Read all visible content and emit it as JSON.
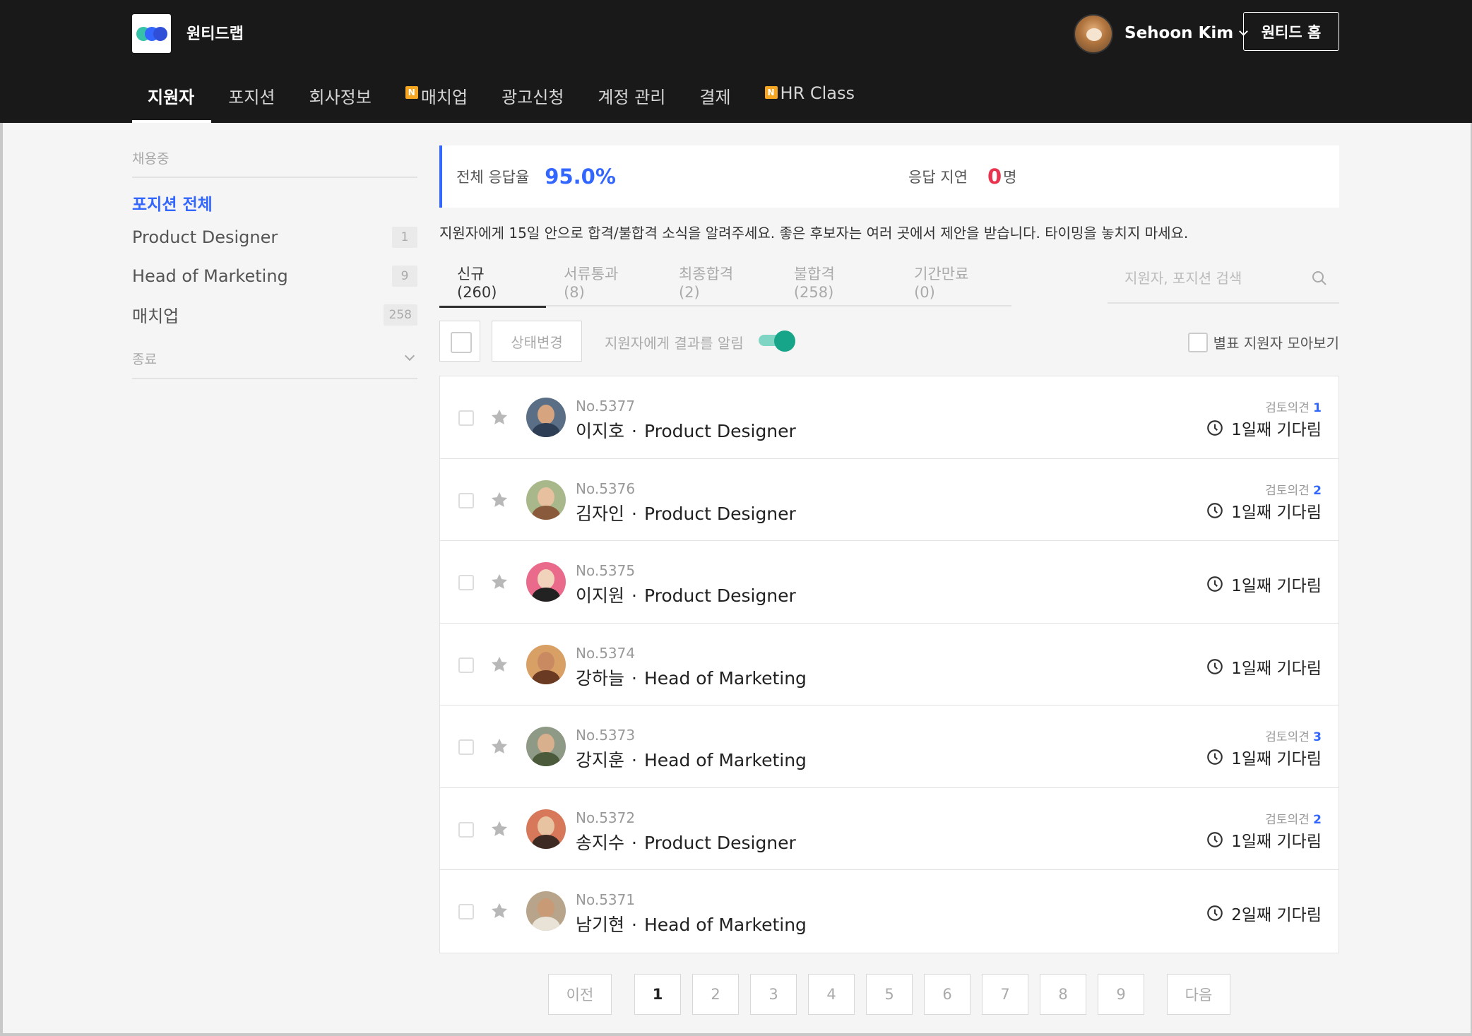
{
  "header": {
    "brand": "원티드랩",
    "user_name": "Sehoon Kim",
    "home_button": "원티드 홈",
    "nav": [
      {
        "label": "지원자",
        "badge": ""
      },
      {
        "label": "포지션",
        "badge": ""
      },
      {
        "label": "회사정보",
        "badge": ""
      },
      {
        "label": "매치업",
        "badge": "N"
      },
      {
        "label": "광고신청",
        "badge": ""
      },
      {
        "label": "계정 관리",
        "badge": ""
      },
      {
        "label": "결제",
        "badge": ""
      },
      {
        "label": "HR Class",
        "badge": "N"
      }
    ]
  },
  "sidebar": {
    "section_active": "채용중",
    "all_positions": "포지션 전체",
    "items": [
      {
        "label": "Product Designer",
        "count": "1"
      },
      {
        "label": "Head of Marketing",
        "count": "9"
      },
      {
        "label": "매치업",
        "count": "258"
      }
    ],
    "section_ended": "종료"
  },
  "stats": {
    "rate_label": "전체 응답율",
    "rate_value": "95.0%",
    "delay_label": "응답 지연",
    "delay_value": "0",
    "delay_unit": "명"
  },
  "notice": "지원자에게 15일 안으로 합격/불합격 소식을 알려주세요. 좋은 후보자는 여러 곳에서 제안을 받습니다. 타이밍을 놓치지 마세요.",
  "tabs": [
    "신규 (260)",
    "서류통과 (8)",
    "최종합격 (2)",
    "불합격 (258)",
    "기간만료 (0)"
  ],
  "search": {
    "placeholder": "지원자, 포지션 검색"
  },
  "toolbar": {
    "status_button": "상태변경",
    "notify_label": "지원자에게 결과를 알림",
    "notify_on": true,
    "star_filter": "별표 지원자 모아보기"
  },
  "applicants": [
    {
      "no": "No.5377",
      "name": "이지호",
      "position": "Product Designer",
      "review_label": "검토의견",
      "review_count": "1",
      "wait": "1일째 기다림"
    },
    {
      "no": "No.5376",
      "name": "김자인",
      "position": "Product Designer",
      "review_label": "검토의견",
      "review_count": "2",
      "wait": "1일째 기다림"
    },
    {
      "no": "No.5375",
      "name": "이지원",
      "position": "Product Designer",
      "review_label": "",
      "review_count": "",
      "wait": "1일째 기다림"
    },
    {
      "no": "No.5374",
      "name": "강하늘",
      "position": "Head of Marketing",
      "review_label": "",
      "review_count": "",
      "wait": "1일째 기다림"
    },
    {
      "no": "No.5373",
      "name": "강지훈",
      "position": "Head of Marketing",
      "review_label": "검토의견",
      "review_count": "3",
      "wait": "1일째 기다림"
    },
    {
      "no": "No.5372",
      "name": "송지수",
      "position": "Product Designer",
      "review_label": "검토의견",
      "review_count": "2",
      "wait": "1일째 기다림"
    },
    {
      "no": "No.5371",
      "name": "남기현",
      "position": "Head of Marketing",
      "review_label": "",
      "review_count": "",
      "wait": "2일째 기다림"
    }
  ],
  "pagination": {
    "prev": "이전",
    "next": "다음",
    "pages": [
      "1",
      "2",
      "3",
      "4",
      "5",
      "6",
      "7",
      "8",
      "9"
    ],
    "current": "1"
  },
  "colors": {
    "accent": "#3366ff",
    "delay": "#e8344e",
    "toggle": "#16a589",
    "header_bg": "#191919",
    "new_badge": "#f5a623"
  }
}
